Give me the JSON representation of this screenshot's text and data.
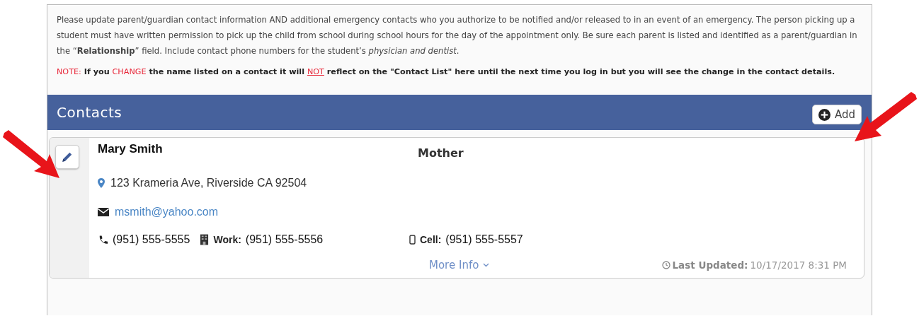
{
  "instructions": {
    "paragraph": "Please update parent/guardian contact information AND additional emergency contacts who you authorize to be notified and/or released to in an event of an emergency. The person picking up a student must have written permission to pick up the child from school during school hours for the day of the appointment only. Be sure each parent is listed and identified as a parent/guardian in the “**Relationship**” field. Include contact phone numbers for the student’s *physician and dentist*.",
    "note": [
      {
        "kind": "alert",
        "text": "NOTE:"
      },
      {
        "kind": "plain",
        "text": " If you "
      },
      {
        "kind": "alert",
        "text": "CHANGE"
      },
      {
        "kind": "plain",
        "text": " the name listed on a contact it will "
      },
      {
        "kind": "alert-underline",
        "text": "NOT"
      },
      {
        "kind": "plain",
        "text": " reflect on the \"Contact List\" here until the next time you log in but you will see the change in the contact details."
      }
    ]
  },
  "contacts": {
    "title": "Contacts",
    "add_button": "Add",
    "items": [
      {
        "name": "Mary Smith",
        "relationship": "Mother",
        "address": "123 Krameria Ave, Riverside CA 92504",
        "email": "msmith@yahoo.com",
        "phones": [
          {
            "kind": "home",
            "number": "(951) 555-5555"
          },
          {
            "kind": "work",
            "label": "Work:",
            "number": "(951) 555-5556"
          },
          {
            "kind": "cell",
            "label": "Cell:",
            "number": "(951) 555-5557"
          }
        ],
        "more_info": "More Info",
        "last_updated_label": "Last Updated:",
        "last_updated": "10/17/2017 8:31 PM"
      }
    ]
  }
}
